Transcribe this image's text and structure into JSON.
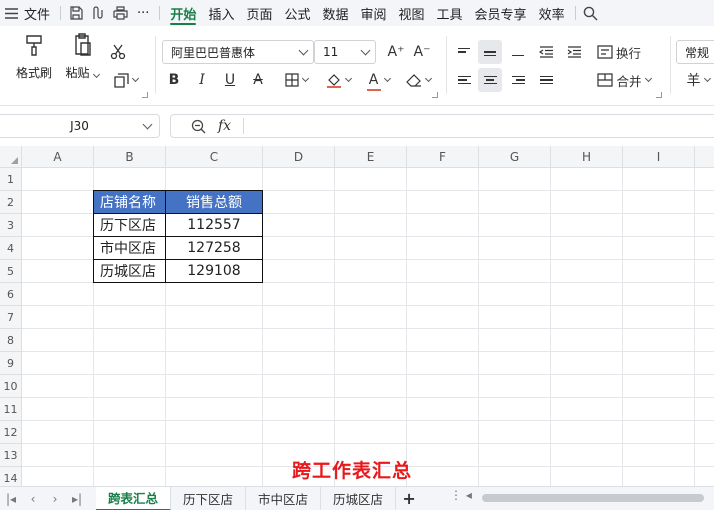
{
  "menu": {
    "file": "文件",
    "more": "···",
    "tabs": [
      "开始",
      "插入",
      "页面",
      "公式",
      "数据",
      "审阅",
      "视图",
      "工具",
      "会员专享",
      "效率"
    ],
    "active_tab": "开始"
  },
  "ribbon": {
    "format_painter": "格式刷",
    "paste": "粘贴",
    "font_name": "阿里巴巴普惠体",
    "font_size": "11",
    "increase_font": "A⁺",
    "decrease_font": "A⁻",
    "bold": "B",
    "italic": "I",
    "underline": "U",
    "strike": "A",
    "font_color": "A",
    "wrap_text": "换行",
    "merge": "合并",
    "number_format": "常规",
    "currency": "羊"
  },
  "formula_bar": {
    "cell_ref": "J30",
    "fx": "fx",
    "content": ""
  },
  "grid": {
    "columns": [
      "A",
      "B",
      "C",
      "D",
      "E",
      "F",
      "G",
      "H",
      "I"
    ],
    "rows": [
      "1",
      "2",
      "3",
      "4",
      "5",
      "6",
      "7",
      "8",
      "9",
      "10",
      "11",
      "12",
      "13",
      "14"
    ]
  },
  "table": {
    "headers": [
      "店铺名称",
      "销售总额"
    ],
    "rows": [
      [
        "历下区店",
        "112557"
      ],
      [
        "市中区店",
        "127258"
      ],
      [
        "历城区店",
        "129108"
      ]
    ],
    "header_color": "#4472c4"
  },
  "overlay": {
    "title": "跨工作表汇总",
    "color": "#e8181b"
  },
  "sheets": {
    "tabs": [
      "跨表汇总",
      "历下区店",
      "市中区店",
      "历城区店"
    ],
    "active": "跨表汇总",
    "add": "+"
  },
  "colors": {
    "accent": "#1a7f4b"
  }
}
